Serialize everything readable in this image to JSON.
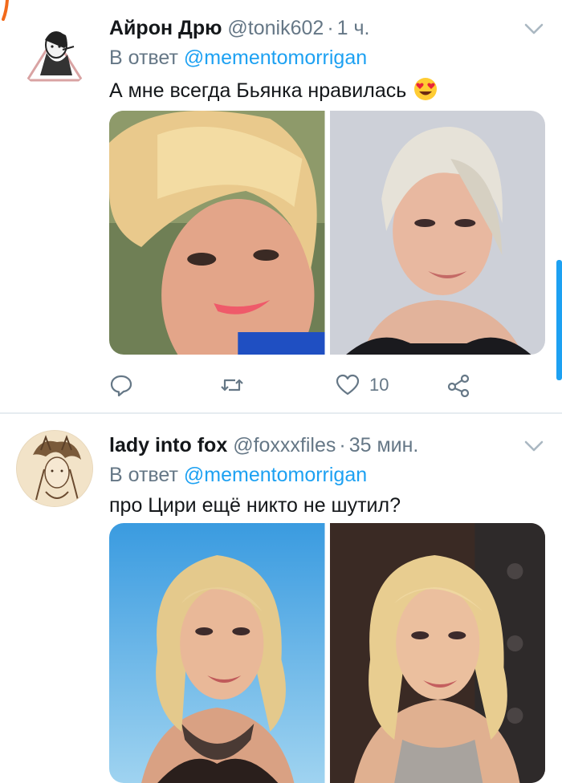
{
  "colors": {
    "accent": "#1da1f2",
    "muted": "#657786",
    "text": "#14171a",
    "divider": "#e6ecf0"
  },
  "tweets": [
    {
      "name": "Айрон Дрю",
      "handle": "@tonik602",
      "separator": "·",
      "time": "1 ч.",
      "reply_prefix": "В ответ",
      "reply_to": "@mementomorrigan",
      "text": "А мне всегда Бьянка нравилась",
      "emoji": "smiling-face-with-heart-eyes",
      "like_count": "10"
    },
    {
      "name": "lady into fox",
      "handle": "@foxxxfiles",
      "separator": "·",
      "time": "35 мин.",
      "reply_prefix": "В ответ",
      "reply_to": "@mementomorrigan",
      "text": "про Цири ещё никто не шутил?"
    }
  ]
}
